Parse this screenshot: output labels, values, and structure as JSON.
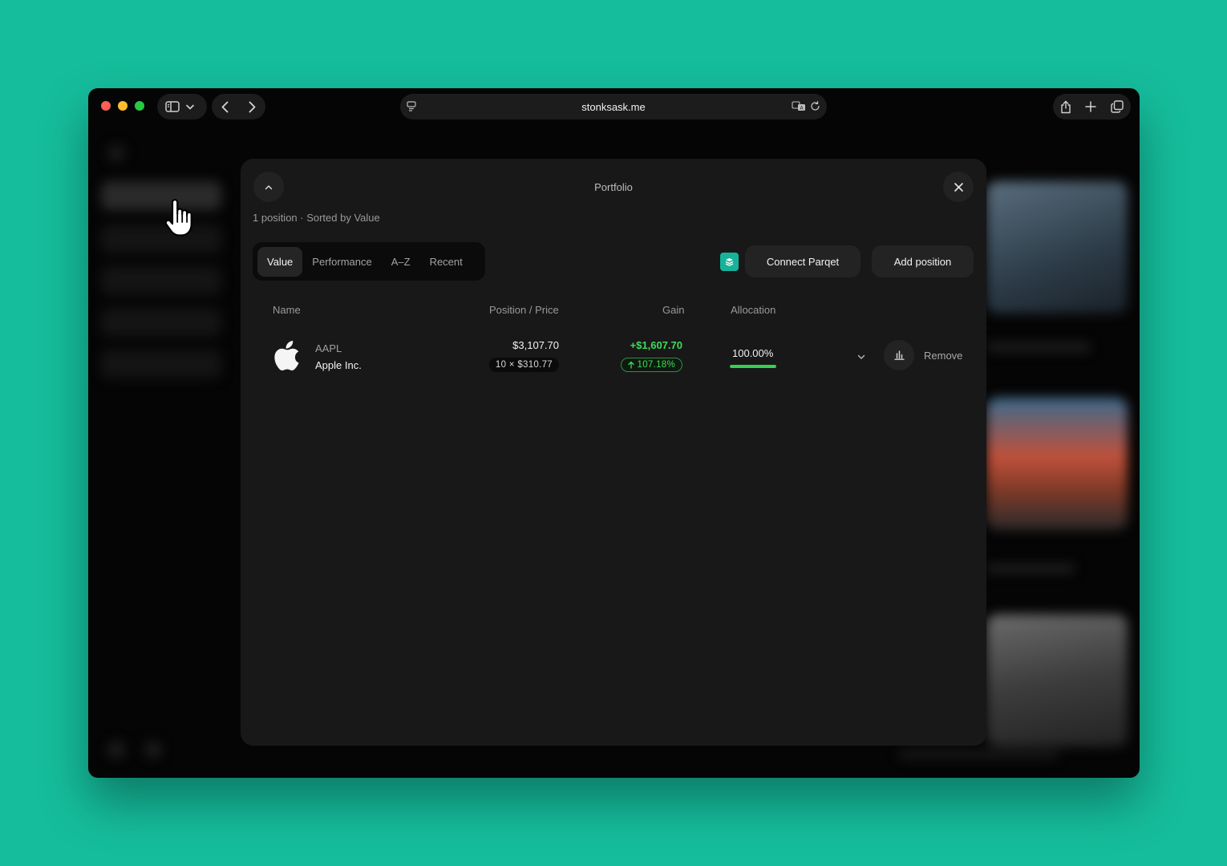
{
  "browser": {
    "url": "stonksask.me"
  },
  "modal": {
    "title": "Portfolio",
    "subtitle": "1 position · Sorted by Value",
    "sort_tabs": [
      {
        "label": "Value",
        "active": true
      },
      {
        "label": "Performance",
        "active": false
      },
      {
        "label": "A–Z",
        "active": false
      },
      {
        "label": "Recent",
        "active": false
      }
    ],
    "connect_label": "Connect Parqet",
    "add_label": "Add position",
    "columns": {
      "name": "Name",
      "position_price": "Position / Price",
      "gain": "Gain",
      "allocation": "Allocation"
    },
    "positions": [
      {
        "ticker": "AAPL",
        "company": "Apple Inc.",
        "value": "$3,107.70",
        "quantity_price": "10 × $310.77",
        "gain_value": "+$1,607.70",
        "gain_percent": "107.18%",
        "allocation": "100.00%",
        "allocation_fraction": 1.0,
        "remove_label": "Remove"
      }
    ]
  },
  "colors": {
    "background": "#15bd9c",
    "gain": "#3ddc58",
    "parqet": "#16b39a"
  },
  "icons": [
    "sidebar-icon",
    "chevron-down-icon",
    "back-icon",
    "forward-icon",
    "site-settings-icon",
    "translate-icon",
    "reload-icon",
    "share-icon",
    "plus-icon",
    "tabs-icon",
    "chevron-up-icon",
    "close-icon",
    "apple-logo-icon",
    "bar-chart-icon",
    "hand-cursor-icon"
  ]
}
